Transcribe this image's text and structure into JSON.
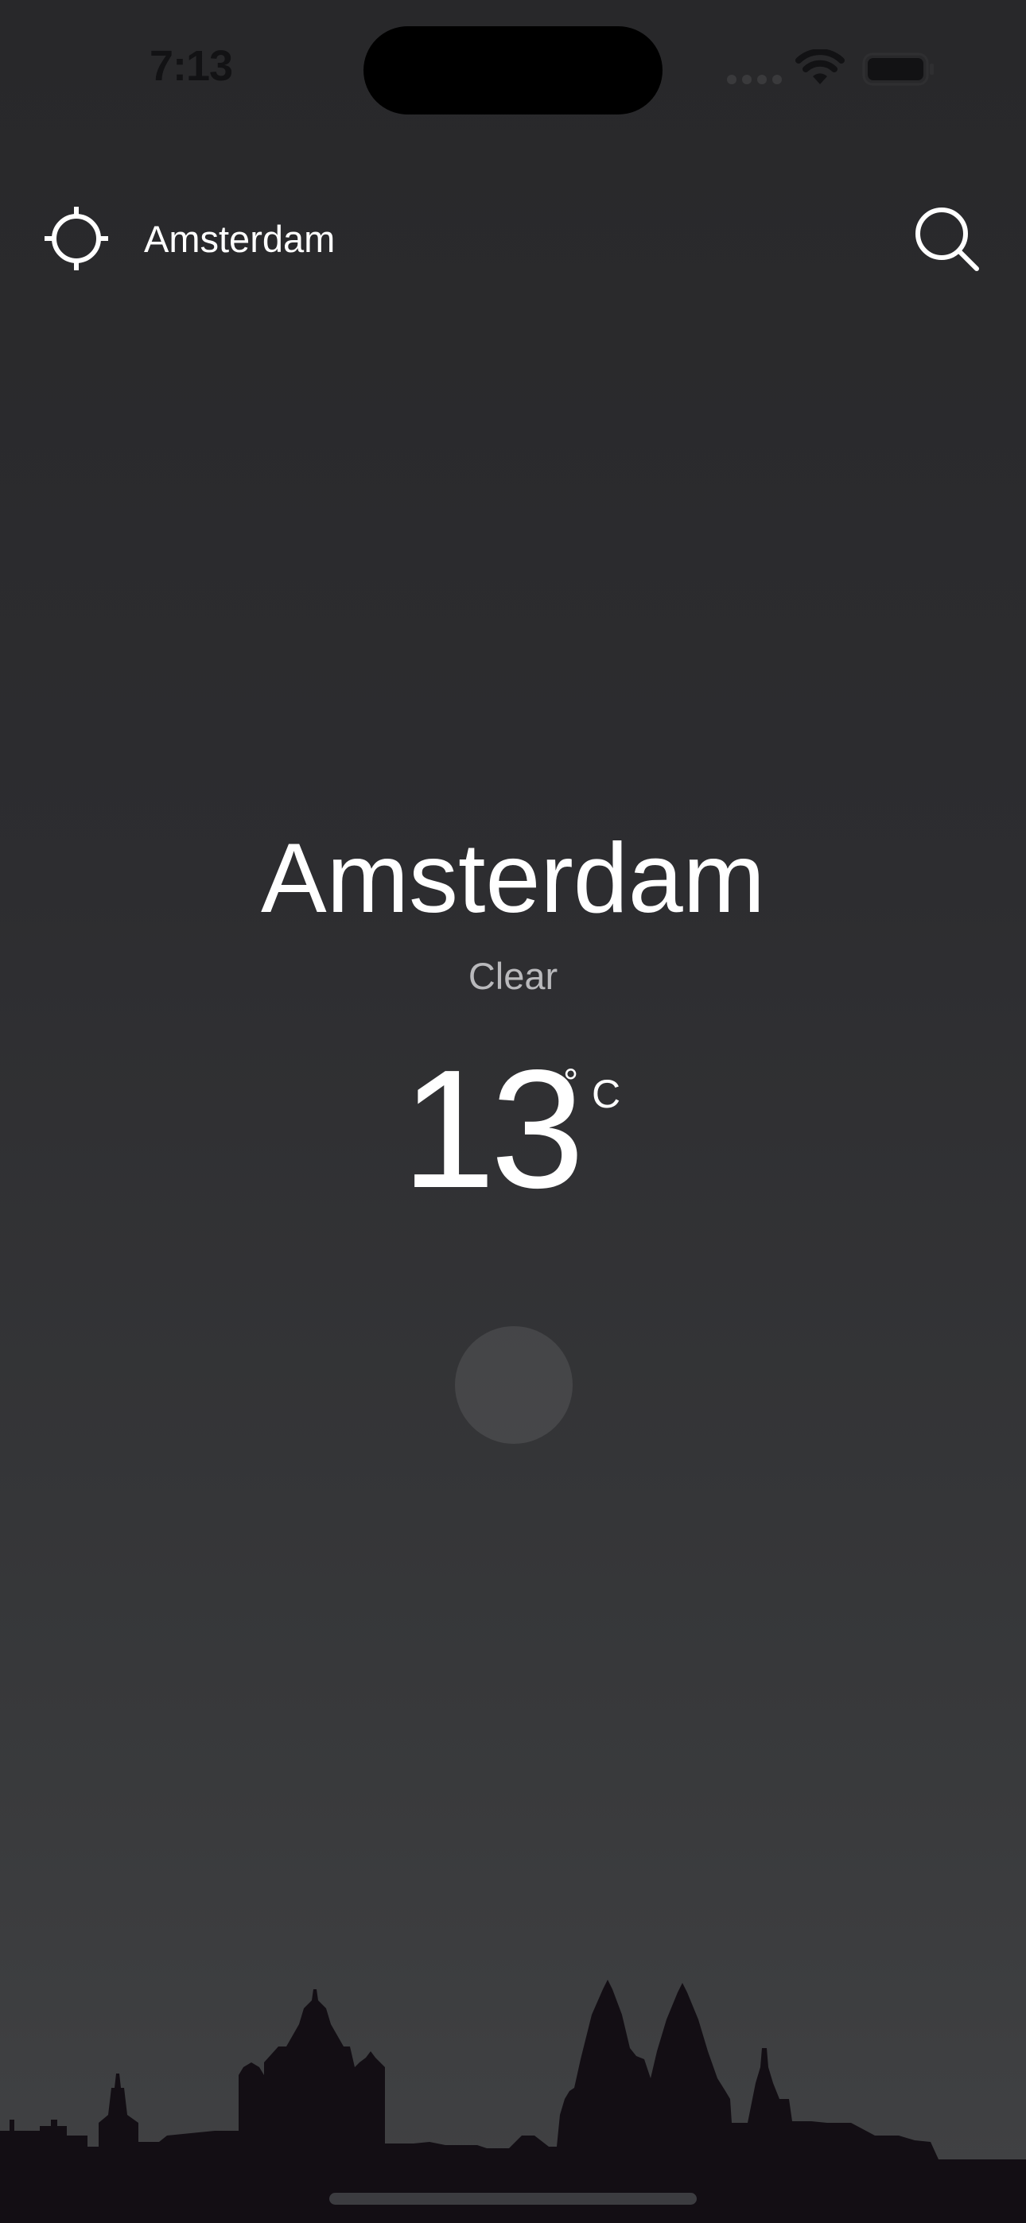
{
  "status_bar": {
    "time": "7:13",
    "time_color": "#121214",
    "icons": [
      "signal-icon",
      "wifi-icon",
      "battery-icon"
    ]
  },
  "header": {
    "location_icon": "crosshair-icon",
    "city": "Amsterdam",
    "search_icon": "search-icon"
  },
  "weather": {
    "city": "Amsterdam",
    "condition": "Clear",
    "temperature": "13",
    "degree_symbol": "°",
    "unit": "C",
    "icon": "sun-icon"
  },
  "skyline": {
    "icon": "city-skyline-silhouette",
    "color": "#130e14"
  },
  "colors": {
    "background_top": "#28282a",
    "background_bottom": "#414244",
    "text_primary": "#ffffff",
    "text_secondary": "#b9b9bc"
  }
}
